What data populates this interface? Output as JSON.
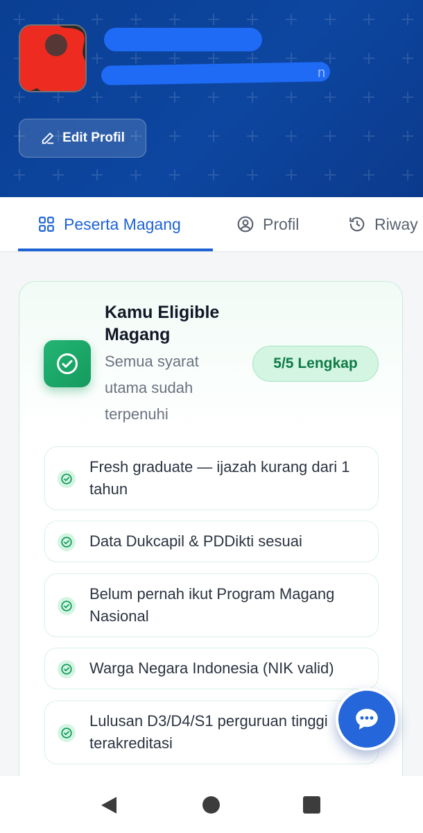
{
  "header": {
    "email_suffix": "n",
    "edit_button_label": "Edit Profil"
  },
  "tabs": [
    {
      "label": "Peserta Magang",
      "icon": "grid-icon",
      "active": true
    },
    {
      "label": "Profil",
      "icon": "user-circle-icon",
      "active": false
    },
    {
      "label": "Riway",
      "icon": "history-icon",
      "active": false
    }
  ],
  "eligibility": {
    "title": "Kamu Eligible Magang",
    "subtitle": "Semua syarat utama sudah terpenuhi",
    "badge": "5/5 Lengkap",
    "icon": "check-circle-icon",
    "requirements": [
      {
        "label": "Fresh graduate — ijazah kurang dari 1 tahun"
      },
      {
        "label": "Data Dukcapil & PDDikti sesuai"
      },
      {
        "label": "Belum pernah ikut Program Magang Nasional"
      },
      {
        "label": "Warga Negara Indonesia (NIK valid)"
      },
      {
        "label": "Lulusan D3/D4/S1 perguruan tinggi terakreditasi"
      }
    ]
  },
  "colors": {
    "header_bg": "#0d46a0",
    "accent": "#1d63d6",
    "success": "#159a5d",
    "badge_bg": "#d3f5e2"
  },
  "fab": {
    "icon": "chat-bubble-icon"
  },
  "system_nav": {
    "back": "back-icon",
    "home": "home-icon",
    "recent": "recent-apps-icon"
  }
}
